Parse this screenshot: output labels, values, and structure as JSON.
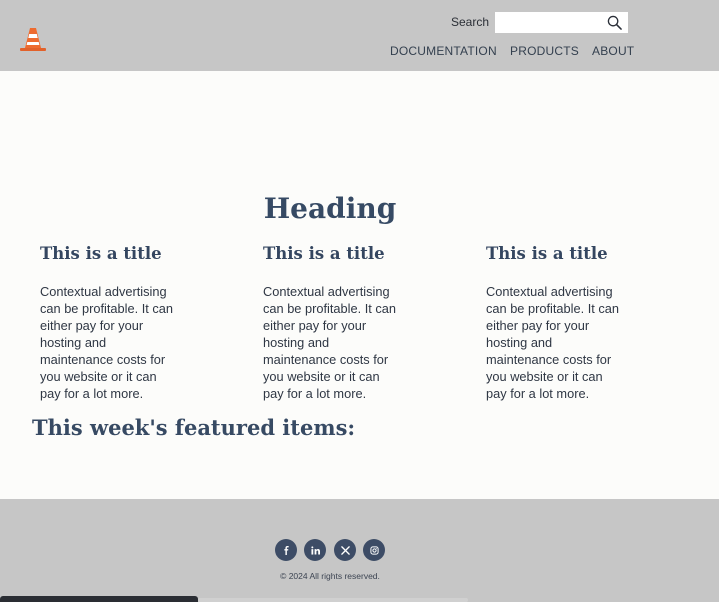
{
  "header": {
    "search": {
      "label": "Search",
      "value": "",
      "placeholder": ""
    },
    "nav": [
      {
        "label": "DOCUMENTATION"
      },
      {
        "label": "PRODUCTS"
      },
      {
        "label": "ABOUT"
      }
    ]
  },
  "main": {
    "heading": "Heading",
    "columns": [
      {
        "title": "This is a title",
        "body": "Contextual advertising can be profitable. It can either pay for your hosting and maintenance costs for you website or it can pay for a lot more."
      },
      {
        "title": "This is a title",
        "body": "Contextual advertising can be profitable. It can either pay for your hosting and maintenance costs for you website or it can pay for a lot more."
      },
      {
        "title": "This is a title",
        "body": "Contextual advertising can be profitable. It can either pay for your hosting and maintenance costs for you website or it can pay for a lot more."
      }
    ],
    "featured_heading": "This week's featured items:"
  },
  "footer": {
    "social": [
      {
        "icon": "facebook-icon"
      },
      {
        "icon": "linkedin-icon"
      },
      {
        "icon": "x-icon"
      },
      {
        "icon": "instagram-icon"
      }
    ],
    "copyright": "© 2024 All rights reserved."
  },
  "colors": {
    "header_bg": "#c6c6c6",
    "page_bg": "#fcfcfa",
    "heading": "#364a64",
    "social_bg": "#3d4c66"
  }
}
